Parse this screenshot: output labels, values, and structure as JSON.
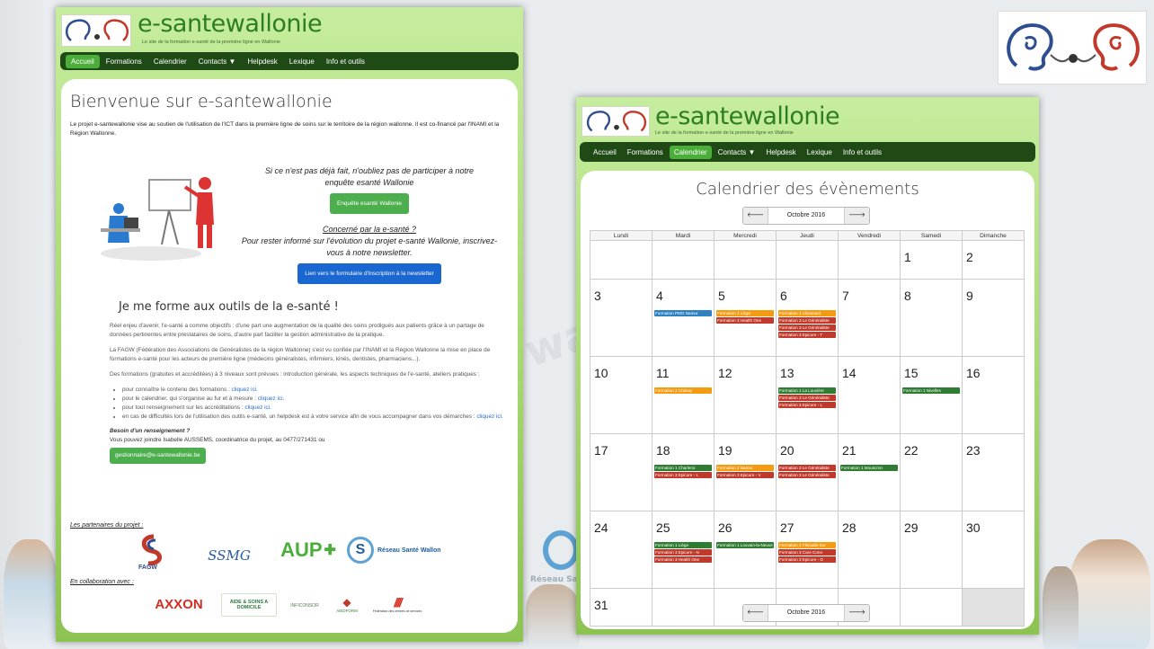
{
  "left_site": {
    "brand": "e-santewallonie",
    "tagline": "Le site de la formation e-santé de la première ligne en Wallonie",
    "nav": [
      "Accueil",
      "Formations",
      "Calendrier",
      "Contacts ▼",
      "Helpdesk",
      "Lexique",
      "Info et outils"
    ],
    "active_nav": "Accueil",
    "page_title": "Bienvenue sur e-santewallonie",
    "intro": "Le projet e-santewallonie vise au soutien de l'utilisation de l'ICT dans la première ligne de soins sur le territoire de la région wallonne. Il est co-financé par l'INAMI et la Région Wallonne.",
    "survey_text": "Si ce n'est pas déjà fait, n'oubliez pas de participer à notre enquête esanté Wallonie",
    "survey_button": "Enquête esanté Wallonie",
    "newsletter_heading": "Concerné par la e-santé ?",
    "newsletter_text": "Pour rester informé sur l'évolution du projet e-santé Wallonie, inscrivez-vous à notre newsletter.",
    "newsletter_button": "Lien vers le formulaire d'inscription à la newsletter",
    "section_title": "Je me forme aux outils de la e-santé !",
    "p1": "Réel enjeu d'avenir, l'e-santé a comme objectifs : d'une part une augmentation de la qualité des soins prodigués aux patients grâce à un partage de données pertinentes entre prestataires de soins, d'autre part faciliter la gestion administrative de la pratique.",
    "p2": "La FAGW (Fédération des Associations de Généralistes de la région Wallonne) s'est vu confiée par l'INAMI et la Région Wallonne la mise en place de formations e-santé pour les acteurs de première ligne (médecins généralistes, infirmiers, kinés, dentistes, pharmaciens...).",
    "p3": "Des formations (gratuites et accréditées) à 3 niveaux sont prévues : introduction générale, les aspects techniques de l'e-santé, ateliers pratiques :",
    "bullets": [
      {
        "text": "pour connaître le contenu des formations : ",
        "link": "cliquez ici."
      },
      {
        "text": "pour le calendrier, qui s'organise au fur et à mesure : ",
        "link": "cliquez ici."
      },
      {
        "text": "pour tout renseignement sur les accréditations : ",
        "link": "cliquez ici."
      },
      {
        "text": "en cas de difficultés lors de l'utilisation des outils e-santé, un helpdesk est à votre service afin de vous accompagner dans vos démarches : ",
        "link": "cliquez ici."
      }
    ],
    "question": "Besoin d'un renseignement ?",
    "contact": "Vous pouvez joindre Isabelle AUSSEMS, coordinatrice du projet, au 0477/271431 ou",
    "email_button": "gestionnaire@e-santewallonie.be",
    "partners_label": "Les partenaires du projet :",
    "partners": [
      "FAGW",
      "SSMG",
      "AUP",
      "Réseau Santé Wallon"
    ],
    "collab_label": "En collaboration avec :",
    "collaborators": [
      "AXXON",
      "AIDE & SOINS A DOMICILE",
      "INFICONSOR",
      "AIEDFORM",
      "Fédération des centres de services"
    ]
  },
  "right_site": {
    "brand": "e-santewallonie",
    "tagline": "Le site de la formation e-santé de la première ligne en Wallonie",
    "nav": [
      "Accueil",
      "Formations",
      "Calendrier",
      "Contacts ▼",
      "Helpdesk",
      "Lexique",
      "Info et outils"
    ],
    "active_nav": "Calendrier",
    "calendar_title": "Calendrier des évènements",
    "month": "Octobre 2016",
    "prev": "🡐",
    "next": "🡒",
    "weekdays": [
      "Lundi",
      "Mardi",
      "Mercredi",
      "Jeudi",
      "Vendredi",
      "Samedi",
      "Dimanche"
    ],
    "weeks": [
      [
        {
          "day": "",
          "events": []
        },
        {
          "day": "",
          "events": []
        },
        {
          "day": "",
          "events": []
        },
        {
          "day": "",
          "events": []
        },
        {
          "day": "",
          "events": []
        },
        {
          "day": "1",
          "events": []
        },
        {
          "day": "2",
          "events": []
        }
      ],
      [
        {
          "day": "3",
          "events": []
        },
        {
          "day": "4",
          "events": [
            {
              "t": "Formation PMG Namur",
              "c": "blue"
            }
          ]
        },
        {
          "day": "5",
          "events": [
            {
              "t": "Formation 2 Liège",
              "c": "orange"
            },
            {
              "t": "Formation 3 Health One",
              "c": "red"
            }
          ]
        },
        {
          "day": "6",
          "events": [
            {
              "t": "Formation 2 Libramont",
              "c": "orange"
            },
            {
              "t": "Formation 3 Le Généraliste",
              "c": "red"
            },
            {
              "t": "Formation 3 Le Généraliste",
              "c": "red"
            },
            {
              "t": "Formation 3 Epicure - T",
              "c": "red"
            }
          ]
        },
        {
          "day": "7",
          "events": []
        },
        {
          "day": "8",
          "events": []
        },
        {
          "day": "9",
          "events": []
        }
      ],
      [
        {
          "day": "10",
          "events": []
        },
        {
          "day": "11",
          "events": [
            {
              "t": "Formation 2 Chimay",
              "c": "orange"
            }
          ]
        },
        {
          "day": "12",
          "events": []
        },
        {
          "day": "13",
          "events": [
            {
              "t": "Formation 1 La Louvière",
              "c": "green"
            },
            {
              "t": "Formation 3 Le Généraliste",
              "c": "red"
            },
            {
              "t": "Formation 3 Epicure - L",
              "c": "red"
            }
          ]
        },
        {
          "day": "14",
          "events": []
        },
        {
          "day": "15",
          "events": [
            {
              "t": "Formation 1 Nivelles",
              "c": "green"
            }
          ]
        },
        {
          "day": "16",
          "events": []
        }
      ],
      [
        {
          "day": "17",
          "events": []
        },
        {
          "day": "18",
          "events": [
            {
              "t": "Formation 1 Charleroi",
              "c": "green"
            },
            {
              "t": "Formation 3 Epicure - L",
              "c": "red"
            }
          ]
        },
        {
          "day": "19",
          "events": [
            {
              "t": "Formation 2 Namur",
              "c": "orange"
            },
            {
              "t": "Formation 3 Epicure - V",
              "c": "red"
            }
          ]
        },
        {
          "day": "20",
          "events": [
            {
              "t": "Formation 3 Le Généraliste",
              "c": "red"
            },
            {
              "t": "Formation 3 Le Généraliste",
              "c": "red"
            }
          ]
        },
        {
          "day": "21",
          "events": [
            {
              "t": "Formation 1 Mouscron",
              "c": "green"
            }
          ]
        },
        {
          "day": "22",
          "events": []
        },
        {
          "day": "23",
          "events": []
        }
      ],
      [
        {
          "day": "24",
          "events": []
        },
        {
          "day": "25",
          "events": [
            {
              "t": "Formation 1 Liège",
              "c": "green"
            },
            {
              "t": "Formation 3 Epicure - N",
              "c": "red"
            },
            {
              "t": "Formation 3 Health One",
              "c": "red"
            }
          ]
        },
        {
          "day": "26",
          "events": [
            {
              "t": "Formation 1 Louvain-la-Neuve",
              "c": "green"
            }
          ]
        },
        {
          "day": "27",
          "events": [
            {
              "t": "Formation 2 Flémalle-Sur",
              "c": "orange"
            },
            {
              "t": "Formation 3 Care Conn",
              "c": "red"
            },
            {
              "t": "Formation 3 Epicure - D",
              "c": "red"
            }
          ]
        },
        {
          "day": "28",
          "events": []
        },
        {
          "day": "29",
          "events": []
        },
        {
          "day": "30",
          "events": []
        }
      ],
      [
        {
          "day": "31",
          "events": []
        },
        {
          "day": "",
          "events": []
        },
        {
          "day": "",
          "events": []
        },
        {
          "day": "",
          "events": []
        },
        {
          "day": "",
          "events": []
        },
        {
          "day": "",
          "events": []
        },
        {
          "day": "",
          "events": [],
          "gray": true
        }
      ]
    ]
  },
  "background": {
    "watermark_1": "wallonie",
    "watermark_2": "Réseau Santé"
  },
  "colors": {
    "header_green": "#a6d96f",
    "nav_dark": "#1f4a16",
    "nav_active": "#4cae3a",
    "brand": "#2d7d22",
    "event_blue": "#2f82c2",
    "event_orange": "#f39c12",
    "event_red": "#c0392b",
    "event_green": "#2e7d32"
  }
}
